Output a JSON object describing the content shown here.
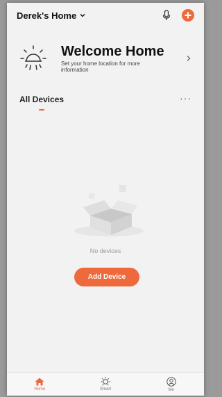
{
  "header": {
    "home_name": "Derek's Home"
  },
  "welcome": {
    "title": "Welcome Home",
    "subtitle": "Set your home location for more information"
  },
  "devices": {
    "tab_label": "All Devices",
    "more_glyph": "···",
    "empty_text": "No devices",
    "add_button": "Add Device"
  },
  "tabbar": {
    "items": [
      {
        "label": "Home",
        "icon": "home-icon",
        "active": true
      },
      {
        "label": "Smart",
        "icon": "sun-icon",
        "active": false
      },
      {
        "label": "Me",
        "icon": "user-icon",
        "active": false
      }
    ]
  },
  "colors": {
    "accent": "#ee6a3c",
    "background": "#f2f2f2"
  }
}
